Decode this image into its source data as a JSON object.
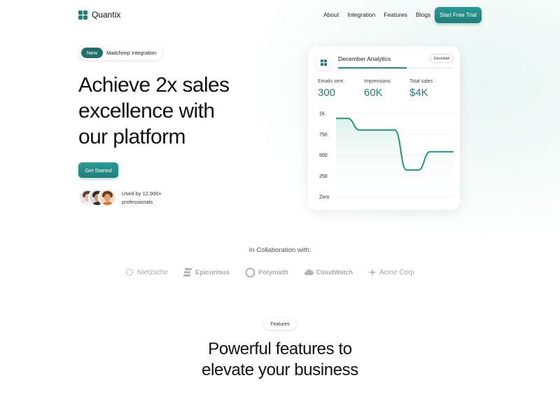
{
  "nav": {
    "brand": "Quantix",
    "links": [
      "About",
      "Integration",
      "Features",
      "Blogs"
    ],
    "cta": "Start Free Trial"
  },
  "hero": {
    "badge_new": "New",
    "badge_text": "Mailchimp Integration",
    "headline": "Achieve 2x sales excellence with our platform",
    "cta": "Get Started",
    "social_proof": "Used by 12,900+ professionals"
  },
  "analytics_card": {
    "title": "December Analytics",
    "download": "Download",
    "stats": [
      {
        "label": "Emails sent",
        "value": "300"
      },
      {
        "label": "Impressions",
        "value": "60K"
      },
      {
        "label": "Total sales",
        "value": "$4K"
      }
    ]
  },
  "chart_data": {
    "type": "line",
    "title": "",
    "xlabel": "",
    "ylabel": "",
    "y_ticks": [
      "1K",
      "750",
      "500",
      "250",
      "Zero"
    ],
    "ylim": [
      0,
      1000
    ],
    "grid": true,
    "x": [
      0,
      1,
      2,
      3,
      4,
      5,
      6,
      7,
      8,
      9,
      10
    ],
    "series": [
      {
        "values": [
          940,
          940,
          800,
          800,
          800,
          800,
          320,
          320,
          540,
          540,
          540
        ]
      }
    ],
    "color": "#1f9a78"
  },
  "collaboration": {
    "title": "In Collaboration with:",
    "brands": [
      "Nietzsche",
      "Epicurious",
      "Polymath",
      "CloudWatch",
      "Acme Corp"
    ]
  },
  "features": {
    "tag": "Features",
    "title_line1": "Powerful features to",
    "title_line2": "elevate your business"
  },
  "colors": {
    "accent": "#1e7e79",
    "chart_line": "#1f9a78",
    "muted_logo": "#a9a9a9"
  }
}
